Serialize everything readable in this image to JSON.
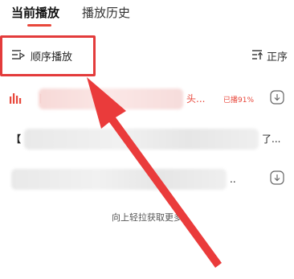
{
  "tabs": {
    "current": "当前播放",
    "history": "播放历史"
  },
  "toolbar": {
    "order_mode_label": "顺序播放",
    "sort_label": "正序"
  },
  "list": {
    "row1": {
      "prefix": "【",
      "suffix": "头...",
      "progress": "已播91%"
    },
    "row2": {
      "prefix": "【",
      "suffix": "了..."
    },
    "row3": {
      "suffix": ".."
    }
  },
  "footer": "向上轻拉获取更多",
  "colors": {
    "accent": "#e8483c",
    "highlight_box": "#e33b3b"
  },
  "icons": [
    "order-list-icon",
    "sort-icon",
    "playing-bars-icon",
    "download-icon"
  ]
}
